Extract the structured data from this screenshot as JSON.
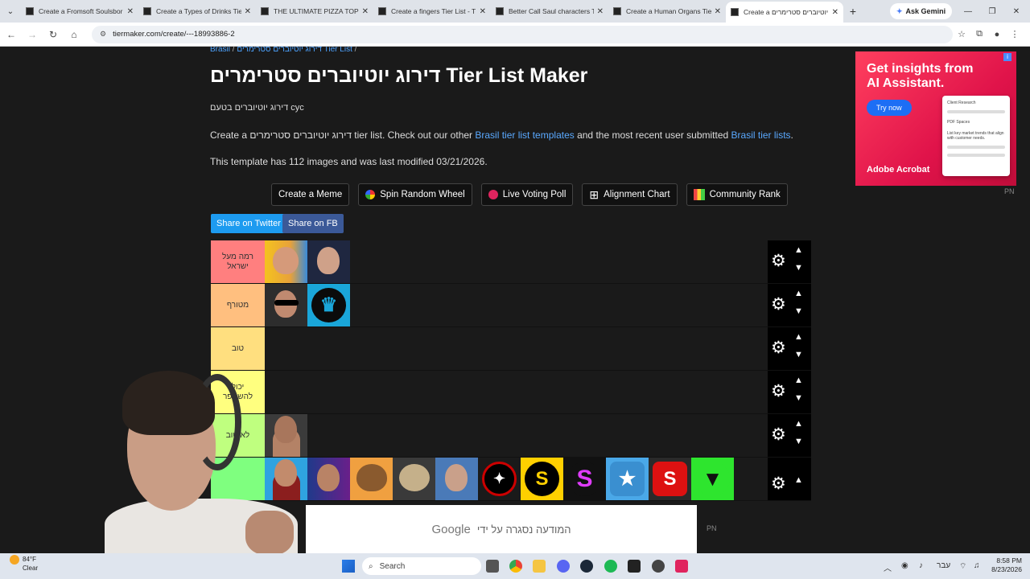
{
  "browser": {
    "tabs": [
      {
        "title": "Create a Fromsoft Soulsbor"
      },
      {
        "title": "Create a Types of Drinks Tie"
      },
      {
        "title": "THE ULTIMATE PIZZA TOPPI"
      },
      {
        "title": "Create a fingers Tier List - T"
      },
      {
        "title": "Better Call Saul characters T"
      },
      {
        "title": "Create a Human Organs Tier"
      },
      {
        "title": "Create a דירוג יוטיוברים סטרימרים"
      }
    ],
    "gemini_label": "Ask Gemini",
    "url": "tiermaker.com/create/---18993886-2"
  },
  "page": {
    "breadcrumb": [
      "Brasil",
      "/",
      "דירוג יוטיוברים סטרימרים Tier List",
      "/"
    ],
    "title": "דירוג יוטיוברים סטרימרים Tier List Maker",
    "description": "דירוג יוטיוברים בטעם cyc",
    "para_prefix": "Create a דירוג יוטיוברים סטרימרים tier list. Check out our other ",
    "para_link1": "Brasil tier list templates",
    "para_mid": " and the most recent user submitted ",
    "para_link2": "Brasil tier lists",
    "para_suffix": ".",
    "template_info": "This template has 112 images and was last modified 03/21/2026.",
    "buttons": [
      {
        "label": "Create a Meme"
      },
      {
        "label": "Spin Random Wheel"
      },
      {
        "label": "Live Voting Poll"
      },
      {
        "label": "Alignment Chart"
      },
      {
        "label": "Community Rank"
      }
    ],
    "share_twitter": "Share on Twitter",
    "share_fb": "Share on FB"
  },
  "tiers": [
    {
      "label": "רמה מעל ישראל",
      "color": "#ff7f7f"
    },
    {
      "label": "מטורף",
      "color": "#ffbf7f"
    },
    {
      "label": "טוב",
      "color": "#ffdf7f"
    },
    {
      "label": "יכול להשתפר",
      "color": "#ffff7f"
    },
    {
      "label": "לא טוב",
      "color": "#bfff7f"
    },
    {
      "label": "",
      "color": "#7fff7f"
    }
  ],
  "ad": {
    "title_line1": "Get insights from",
    "title_line2": "AI Assistant.",
    "cta": "Try now",
    "brand": "Adobe Acrobat",
    "card_text1": "Client Research",
    "card_text2": "PDF Spaces",
    "card_text3": "List key market trends that align with customer needs.",
    "pn": "PN"
  },
  "overlay": {
    "google": "Google",
    "text": "המודעה נסגרה על ידי",
    "pn": "PN"
  },
  "taskbar": {
    "weather_temp": "84°F",
    "weather_cond": "Clear",
    "search": "Search",
    "lang": "עבר",
    "time": "8:58 PM",
    "date": "8/23/2026"
  }
}
